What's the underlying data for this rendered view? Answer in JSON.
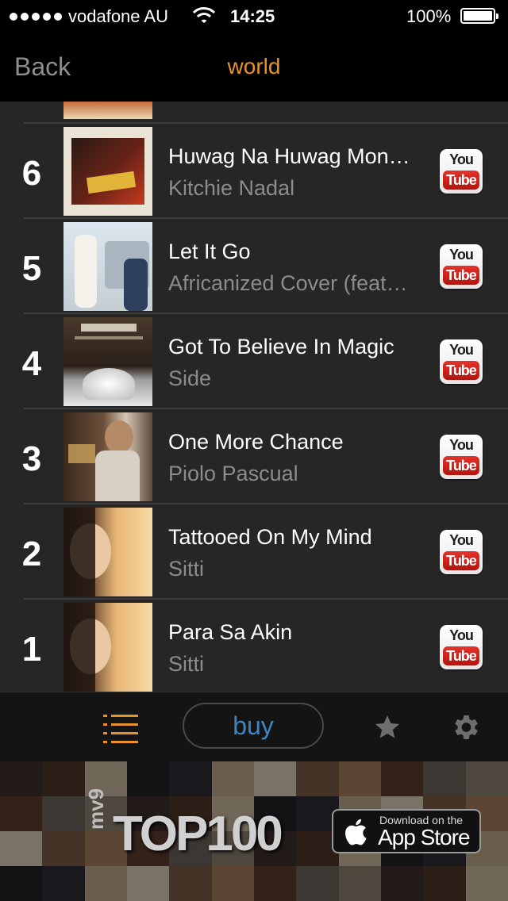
{
  "status_bar": {
    "carrier": "vodafone AU",
    "time": "14:25",
    "battery": "100%",
    "battery_level": 1.0
  },
  "nav": {
    "back_label": "Back",
    "title": "world"
  },
  "tracks": [
    {
      "rank": "6",
      "title": "Huwag Na Huwag Mon…",
      "artist": "Kitchie Nadal"
    },
    {
      "rank": "5",
      "title": "Let It Go",
      "artist": "Africanized Cover (feat…"
    },
    {
      "rank": "4",
      "title": "Got To Believe In Magic",
      "artist": "Side"
    },
    {
      "rank": "3",
      "title": "One More Chance",
      "artist": "Piolo Pascual"
    },
    {
      "rank": "2",
      "title": "Tattooed On My Mind",
      "artist": "Sitti"
    },
    {
      "rank": "1",
      "title": "Para Sa Akin",
      "artist": "Sitti"
    }
  ],
  "youtube_badge": {
    "top": "You",
    "bottom": "Tube"
  },
  "toolbar": {
    "buy_label": "buy",
    "list_icon": "list-icon",
    "star_icon": "star-icon",
    "gear_icon": "gear-icon"
  },
  "ad": {
    "brand": "mv9",
    "headline": "TOP100",
    "store_line1": "Download on the",
    "store_line2": "App Store"
  },
  "colors": {
    "accent": "#e8922a",
    "buy": "#3c87c2",
    "youtube_red": "#cc1a14"
  }
}
